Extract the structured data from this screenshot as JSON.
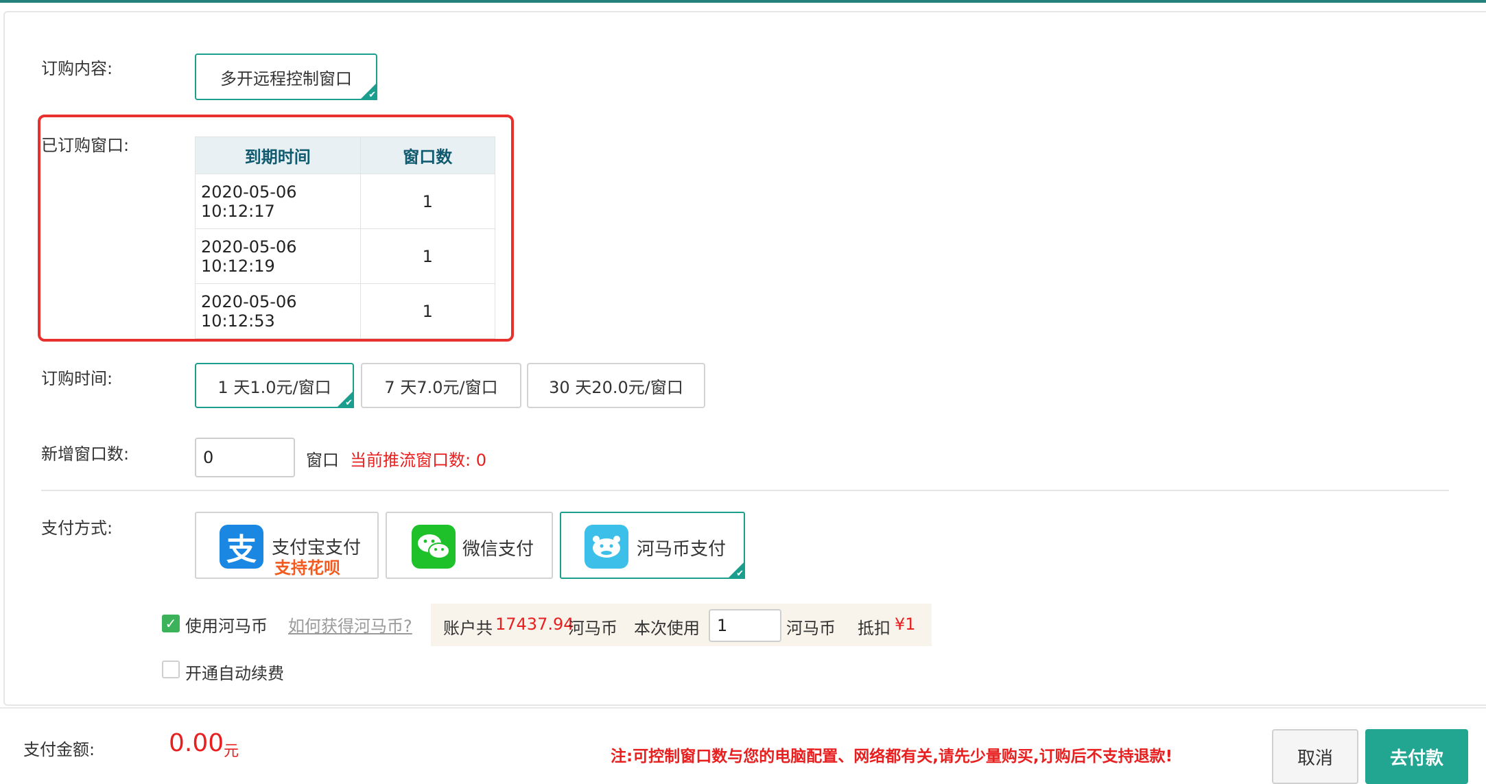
{
  "form": {
    "content_label": "订购内容:",
    "content_option": "多开远程控制窗口",
    "ordered_label": "已订购窗口:",
    "orders_table": {
      "headers": [
        "到期时间",
        "窗口数"
      ],
      "rows": [
        [
          "2020-05-06 10:12:17",
          "1"
        ],
        [
          "2020-05-06 10:12:19",
          "1"
        ],
        [
          "2020-05-06 10:12:53",
          "1"
        ]
      ]
    },
    "duration_label": "订购时间:",
    "duration_options": [
      "1 天1.0元/窗口",
      "7 天7.0元/窗口",
      "30 天20.0元/窗口"
    ],
    "duration_selected": "1 天1.0元/窗口",
    "new_windows_label": "新增窗口数:",
    "new_windows_value": "0",
    "new_windows_unit": "窗口",
    "current_push_text": "当前推流窗口数: 0",
    "payment_label": "支付方式:",
    "payment_methods": [
      {
        "name": "支付宝支付",
        "sub": "支持花呗",
        "icon": "alipay-icon"
      },
      {
        "name": "微信支付",
        "icon": "wechat-icon"
      },
      {
        "name": "河马币支付",
        "icon": "hippo-coin-icon"
      }
    ],
    "payment_selected": "河马币支付",
    "use_coin_label": "使用河马币",
    "use_coin_checked": true,
    "how_to_get_link": "如何获得河马币?",
    "account_prefix": "账户共",
    "account_amount": "17437.94",
    "account_suffix": "河马币",
    "use_now_label": "本次使用",
    "use_now_value": "1",
    "coin_unit": "河马币",
    "deduct_label": "抵扣",
    "deduct_value": "¥1",
    "auto_renew_label": "开通自动续费",
    "auto_renew_checked": false
  },
  "footer": {
    "amount_label": "支付金额:",
    "amount_value": "0.00",
    "amount_unit": "元",
    "notice": "注:可控制窗口数与您的电脑配置、网络都有关,请先少量购买,订购后不支持退款!",
    "cancel_label": "取消",
    "pay_label": "去付款"
  },
  "colors": {
    "accent": "#1c9e8f",
    "highlight_box": "#e8302c",
    "warning_text": "#e81f1f",
    "pay_button": "#22a692"
  }
}
